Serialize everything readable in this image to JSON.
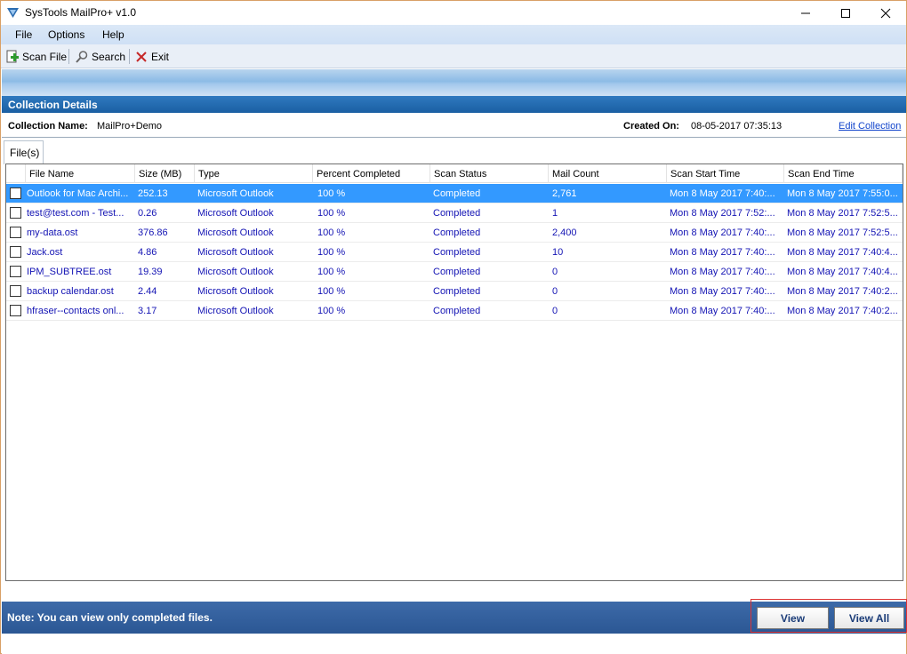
{
  "window": {
    "title": "SysTools MailPro+ v1.0"
  },
  "menu": [
    "File",
    "Options",
    "Help"
  ],
  "toolbar": {
    "scan_file": "Scan File",
    "search": "Search",
    "exit": "Exit"
  },
  "section": {
    "title": "Collection Details"
  },
  "collection": {
    "name_label": "Collection Name:",
    "name_value": "MailPro+Demo",
    "created_label": "Created On:",
    "created_value": "08-05-2017 07:35:13",
    "edit_link": "Edit Collection"
  },
  "tabs": [
    "File(s)"
  ],
  "grid": {
    "columns": [
      "File Name",
      "Size (MB)",
      "Type",
      "Percent Completed",
      "Scan Status",
      "Mail Count",
      "Scan Start Time",
      "Scan End Time"
    ],
    "rows": [
      {
        "file": "Outlook for Mac Archi...",
        "size": "252.13",
        "type": "Microsoft Outlook",
        "percent": "100 %",
        "status": "Completed",
        "count": "2,761",
        "start": "Mon 8 May 2017 7:40:...",
        "end": "Mon 8 May 2017 7:55:0...",
        "selected": true
      },
      {
        "file": "test@test.com - Test...",
        "size": "0.26",
        "type": "Microsoft Outlook",
        "percent": "100 %",
        "status": "Completed",
        "count": "1",
        "start": "Mon 8 May 2017 7:52:...",
        "end": "Mon 8 May 2017 7:52:5...",
        "selected": false
      },
      {
        "file": "my-data.ost",
        "size": "376.86",
        "type": "Microsoft Outlook",
        "percent": "100 %",
        "status": "Completed",
        "count": "2,400",
        "start": "Mon 8 May 2017 7:40:...",
        "end": "Mon 8 May 2017 7:52:5...",
        "selected": false
      },
      {
        "file": "Jack.ost",
        "size": "4.86",
        "type": "Microsoft Outlook",
        "percent": "100 %",
        "status": "Completed",
        "count": "10",
        "start": "Mon 8 May 2017 7:40:...",
        "end": "Mon 8 May 2017 7:40:4...",
        "selected": false
      },
      {
        "file": "IPM_SUBTREE.ost",
        "size": "19.39",
        "type": "Microsoft Outlook",
        "percent": "100 %",
        "status": "Completed",
        "count": "0",
        "start": "Mon 8 May 2017 7:40:...",
        "end": "Mon 8 May 2017 7:40:4...",
        "selected": false
      },
      {
        "file": "backup calendar.ost",
        "size": "2.44",
        "type": "Microsoft Outlook",
        "percent": "100 %",
        "status": "Completed",
        "count": "0",
        "start": "Mon 8 May 2017 7:40:...",
        "end": "Mon 8 May 2017 7:40:2...",
        "selected": false
      },
      {
        "file": "hfraser--contacts onl...",
        "size": "3.17",
        "type": "Microsoft Outlook",
        "percent": "100 %",
        "status": "Completed",
        "count": "0",
        "start": "Mon 8 May 2017 7:40:...",
        "end": "Mon 8 May 2017 7:40:2...",
        "selected": false
      }
    ]
  },
  "footer": {
    "note": "Note: You can view only completed files.",
    "view": "View",
    "view_all": "View All"
  },
  "colors": {
    "selection": "#3399ff",
    "cell_text": "#1414b4",
    "header_blue": "#1a5fa3",
    "footer_blue": "#2b5794"
  }
}
